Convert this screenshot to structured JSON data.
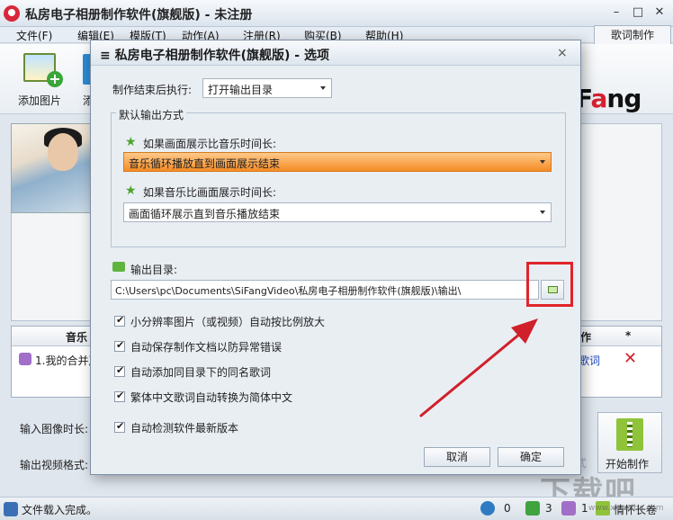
{
  "app": {
    "title": "私房电子相册制作软件(旗舰版) - 未注册",
    "menu": [
      "文件(F)",
      "编辑(E)",
      "模版(T)",
      "动作(A)",
      "注册(R)",
      "购买(B)",
      "帮助(H)"
    ],
    "lyrics_button": "歌词制作",
    "toolbar": {
      "add_picture": "添加图片",
      "add_music_partial": "添"
    },
    "brand_logo": {
      "f": "F",
      "a": "a",
      "ng": "ng"
    },
    "music_table": {
      "headers": [
        "音乐",
        "作",
        "*"
      ],
      "row": {
        "name": "1.我的合并声",
        "lyric": "歌词"
      }
    },
    "bottom_labels": {
      "image_duration": "输入图像时长:",
      "video_format": "输出视频格式:"
    },
    "start_button": "开始制作",
    "start_shadow": "式",
    "status": {
      "text": "文件载入完成。",
      "counts": [
        "0",
        "3",
        "1"
      ],
      "heart": "情怀长卷"
    },
    "watermark": "下载吧",
    "watermark_sub": "www.xiazaiba.com"
  },
  "dialog": {
    "title": "私房电子相册制作软件(旗舰版) - 选项",
    "title_prefix": "≡",
    "close": "×",
    "after_label": "制作结束后执行:",
    "after_value": "打开输出目录",
    "default_group": "默认输出方式",
    "q1_label": "如果画面展示比音乐时间长:",
    "q1_value": "音乐循环播放直到画面展示结束",
    "q2_label": "如果音乐比画面展示时间长:",
    "q2_value": "画面循环展示直到音乐播放结束",
    "outdir_label": "输出目录:",
    "outdir_value": "C:\\Users\\pc\\Documents\\SiFangVideo\\私房电子相册制作软件(旗舰版)\\输出\\",
    "checkboxes": [
      "小分辨率图片（或视频）自动按比例放大",
      "自动保存制作文档以防异常错误",
      "自动添加同目录下的同名歌词",
      "繁体中文歌词自动转换为简体中文",
      "自动检测软件最新版本"
    ],
    "cancel": "取消",
    "ok": "确定"
  },
  "colors": {
    "highlight": "#e0242a",
    "selected_option": "#f58b25",
    "accent_green": "#4ea52d",
    "brand_red": "#d62030"
  },
  "icons": [
    "app-icon",
    "add-picture-icon",
    "star-icon",
    "folder-icon",
    "music-note-icon",
    "delete-icon",
    "zip-icon",
    "annotation-arrow"
  ]
}
